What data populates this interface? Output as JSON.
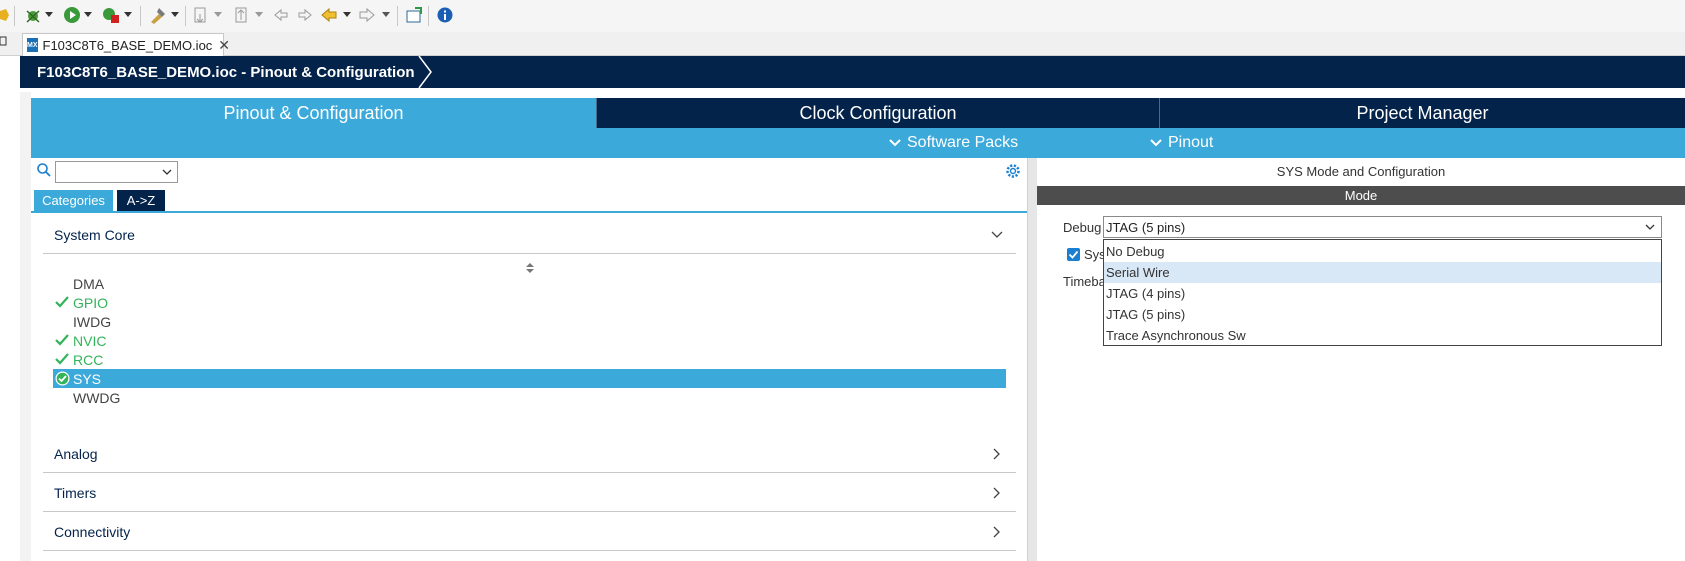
{
  "editor_tab": {
    "icon_text": "MX",
    "label": "F103C8T6_BASE_DEMO.ioc"
  },
  "title_crumb": "F103C8T6_BASE_DEMO.ioc - Pinout & Configuration",
  "main_tabs": [
    {
      "label": "Pinout & Configuration"
    },
    {
      "label": "Clock Configuration"
    },
    {
      "label": "Project Manager"
    }
  ],
  "sub_menu": {
    "software_packs": "Software Packs",
    "pinout": "Pinout"
  },
  "category_tabs": {
    "categories": "Categories",
    "az": "A->Z"
  },
  "sections": {
    "system_core": "System Core",
    "analog": "Analog",
    "timers": "Timers",
    "connectivity": "Connectivity"
  },
  "system_core_items": [
    {
      "label": "DMA",
      "state": "none"
    },
    {
      "label": "GPIO",
      "state": "checked"
    },
    {
      "label": "IWDG",
      "state": "none"
    },
    {
      "label": "NVIC",
      "state": "checked"
    },
    {
      "label": "RCC",
      "state": "checked"
    },
    {
      "label": "SYS",
      "state": "selected"
    },
    {
      "label": "WWDG",
      "state": "none"
    }
  ],
  "right_panel": {
    "title": "SYS Mode and Configuration",
    "mode_header": "Mode",
    "debug_label": "Debug",
    "debug_value": "JTAG (5 pins)",
    "sys_checkbox_label": "Sys",
    "timebase_label": "Timeba",
    "debug_options": [
      "No Debug",
      "Serial Wire",
      "JTAG (4 pins)",
      "JTAG (5 pins)",
      "Trace Asynchronous Sw"
    ],
    "highlighted_option": "Serial Wire"
  },
  "colors": {
    "navy": "#03234b",
    "accent_blue": "#3ca9db",
    "green_check": "#33b35a",
    "mode_bar": "#4d4d4d"
  }
}
